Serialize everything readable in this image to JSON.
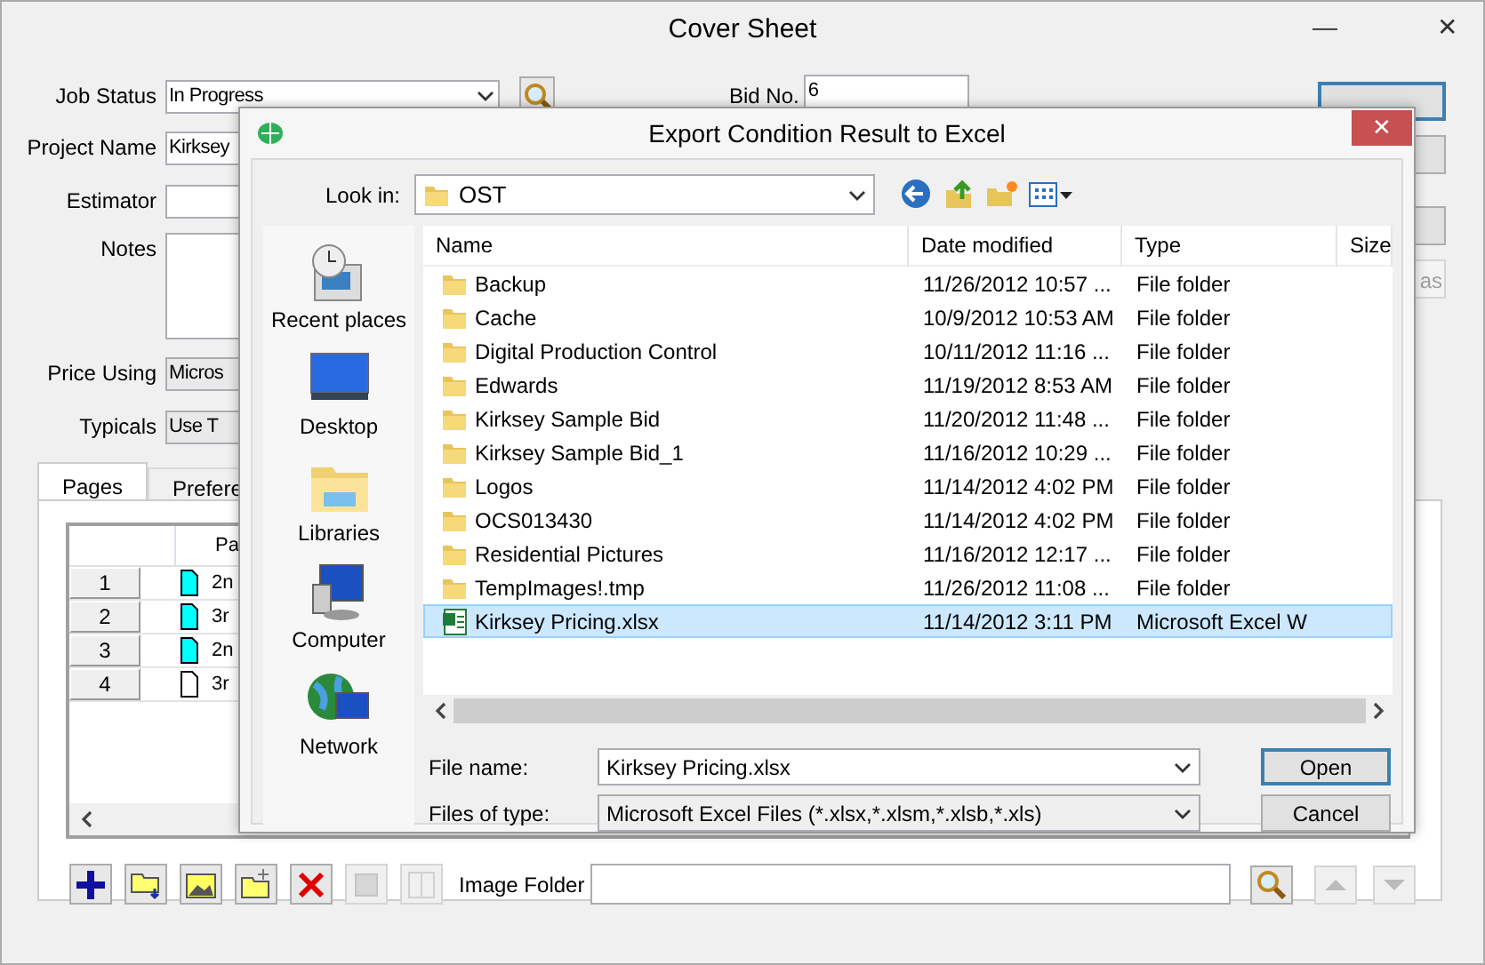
{
  "window": {
    "title": "Cover Sheet",
    "minimize": "—",
    "close": "✕"
  },
  "form": {
    "fields": [
      {
        "label": "Job Status",
        "kind": "select",
        "value": "In Progress"
      },
      {
        "label": "Project Name",
        "kind": "text",
        "value": "Kirksey"
      },
      {
        "label": "Estimator",
        "kind": "text"
      },
      {
        "label": "Notes",
        "kind": "textarea"
      },
      {
        "label": "Price Using",
        "kind": "select",
        "value": "Micros"
      },
      {
        "label": "Typicals",
        "kind": "select",
        "value": "Use T"
      }
    ],
    "bid_no": {
      "label": "Bid No.",
      "value": "6"
    }
  },
  "side_buttons": [
    {
      "default": true,
      "disabled": false
    },
    {
      "default": false,
      "disabled": false
    },
    {
      "default": false,
      "disabled": false
    },
    {
      "label": "as",
      "default": false,
      "disabled": true
    }
  ],
  "tabs": [
    {
      "label": "Pages",
      "selected": true
    },
    {
      "label": "Prefere",
      "selected": false
    }
  ],
  "pages": {
    "column": "Pa",
    "rows": [
      {
        "number": "1",
        "color": "#00ffff",
        "name": "2n"
      },
      {
        "number": "2",
        "color": "#00ffff",
        "name": "3r"
      },
      {
        "number": "3",
        "color": "#00ffff",
        "name": "2n"
      },
      {
        "number": "4",
        "color": "#ffffff",
        "name": "3r"
      }
    ]
  },
  "toolbar": {
    "buttons": [
      {
        "disabled": false
      },
      {
        "disabled": false
      },
      {
        "disabled": false
      },
      {
        "disabled": false
      },
      {
        "disabled": false
      },
      {
        "disabled": true
      },
      {
        "disabled": true
      }
    ],
    "image_folder_label": "Image Folder"
  },
  "dialog": {
    "title": "Export Condition Result to Excel",
    "close": "✕",
    "look_in_label": "Look in:",
    "look_in": "OST",
    "places": [
      "Recent places",
      "Desktop",
      "Libraries",
      "Computer",
      "Network"
    ],
    "columns": [
      "Name",
      "Date modified",
      "Type",
      "Size"
    ],
    "files": [
      {
        "kind": "folder",
        "name": "Backup",
        "date": "11/26/2012 10:57 ...",
        "type": "File folder",
        "selected": false
      },
      {
        "kind": "folder",
        "name": "Cache",
        "date": "10/9/2012 10:53 AM",
        "type": "File folder",
        "selected": false
      },
      {
        "kind": "folder",
        "name": "Digital Production Control",
        "date": "10/11/2012 11:16 ...",
        "type": "File folder",
        "selected": false
      },
      {
        "kind": "folder",
        "name": "Edwards",
        "date": "11/19/2012 8:53 AM",
        "type": "File folder",
        "selected": false
      },
      {
        "kind": "folder",
        "name": "Kirksey Sample Bid",
        "date": "11/20/2012 11:48 ...",
        "type": "File folder",
        "selected": false
      },
      {
        "kind": "folder",
        "name": "Kirksey Sample Bid_1",
        "date": "11/16/2012 10:29 ...",
        "type": "File folder",
        "selected": false
      },
      {
        "kind": "folder",
        "name": "Logos",
        "date": "11/14/2012 4:02 PM",
        "type": "File folder",
        "selected": false
      },
      {
        "kind": "folder",
        "name": "OCS013430",
        "date": "11/14/2012 4:02 PM",
        "type": "File folder",
        "selected": false
      },
      {
        "kind": "folder",
        "name": "Residential Pictures",
        "date": "11/16/2012 12:17 ...",
        "type": "File folder",
        "selected": false
      },
      {
        "kind": "folder",
        "name": "TempImages!.tmp",
        "date": "11/26/2012 11:08 ...",
        "type": "File folder",
        "selected": false
      },
      {
        "kind": "excel",
        "name": "Kirksey Pricing.xlsx",
        "date": "11/14/2012 3:11 PM",
        "type": "Microsoft Excel W",
        "selected": true
      }
    ],
    "file_name_label": "File name:",
    "file_name": "Kirksey Pricing.xlsx",
    "file_type_label": "Files of type:",
    "file_type": "Microsoft Excel Files (*.xlsx,*.xlsm,*.xlsb,*.xls)",
    "buttons": [
      {
        "label": "Open",
        "default": true
      },
      {
        "label": "Cancel",
        "default": false
      }
    ]
  }
}
